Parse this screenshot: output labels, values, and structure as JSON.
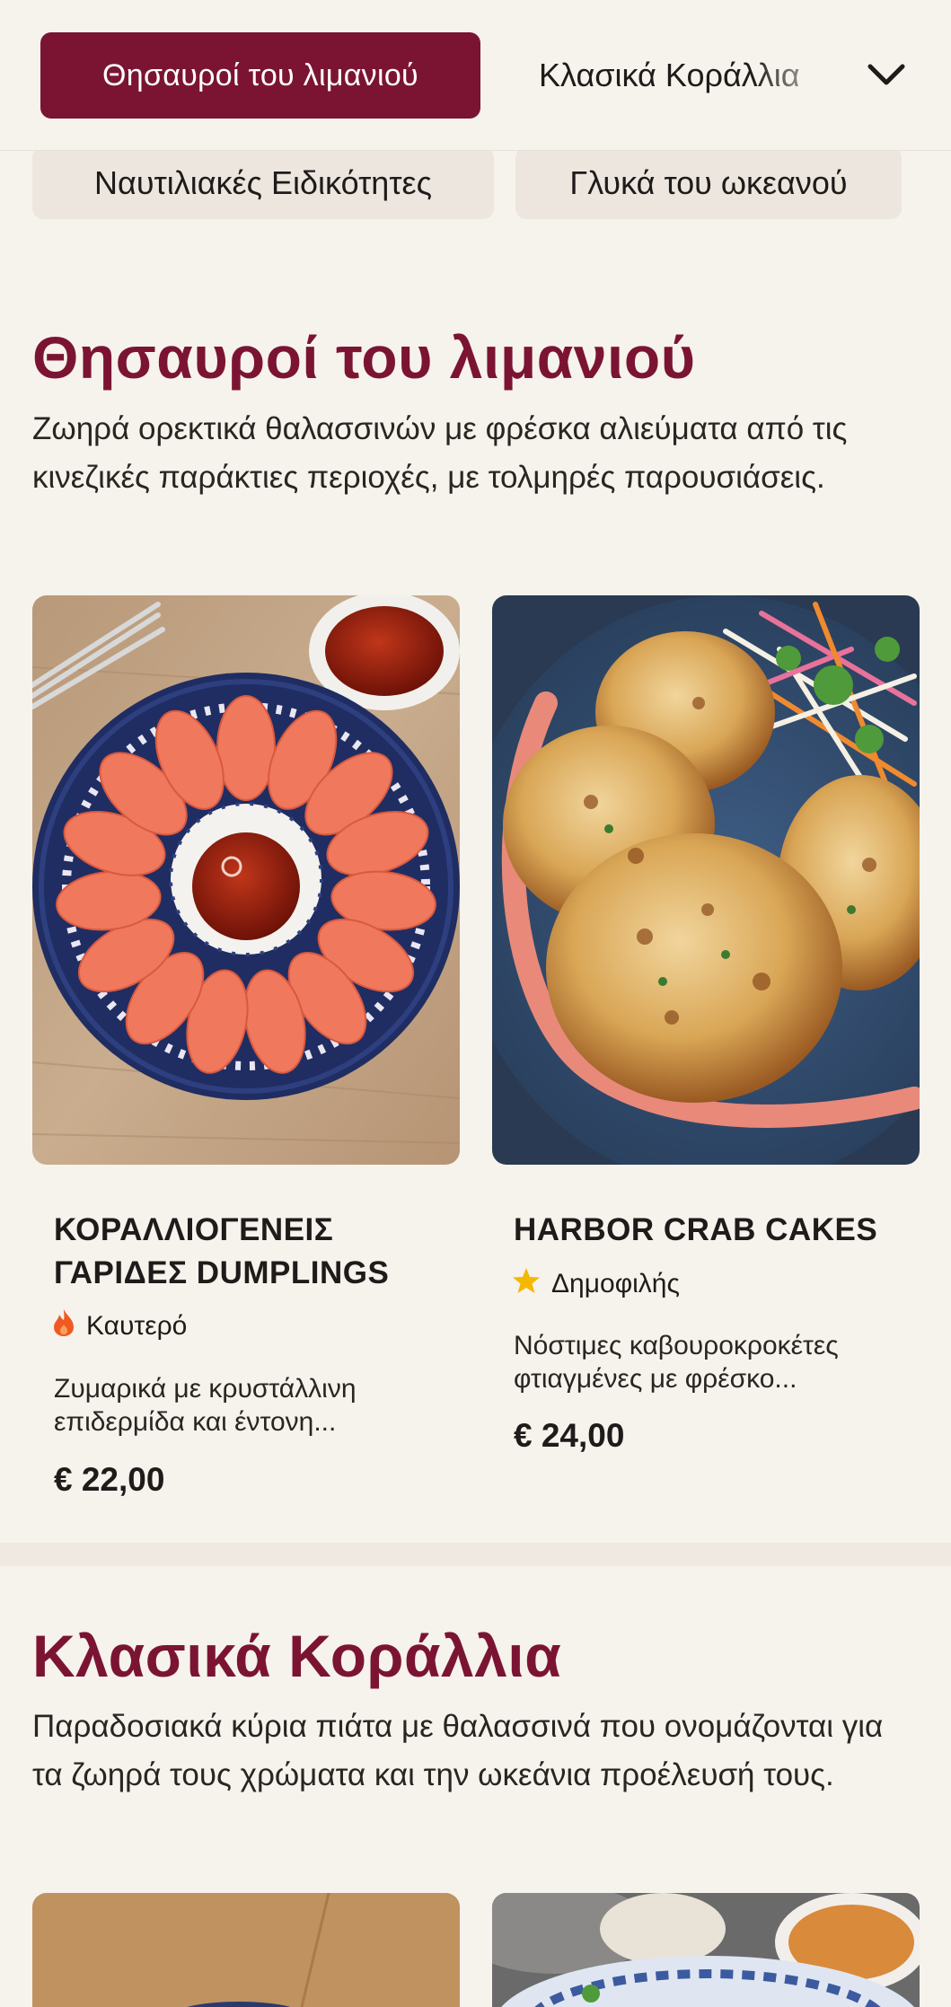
{
  "nav": {
    "active_tab": "Θησαυροί του λιμανιού",
    "next_tab": "Κλασικά Κοράλλια",
    "tabs_row2": [
      "Ναυτιλιακές Ειδικότητες",
      "Γλυκά του ωκεανού"
    ]
  },
  "sections": [
    {
      "title": "Θησαυροί του λιμανιού",
      "description": "Ζωηρά ορεκτικά θαλασσινών με φρέσκα αλιεύματα από τις κινεζικές παράκτιες περιοχές, με τολμηρές παρουσιάσεις.",
      "items": [
        {
          "name": "ΚΟΡΑΛΛΙΟΓΕΝΕΙΣ ΓΑΡΙΔΕΣ DUMPLINGS",
          "badge": "Καυτερό",
          "badge_icon": "flame-icon",
          "description": "Ζυμαρικά με κρυστάλλινη επιδερμίδα και έντονη...",
          "price": "€ 22,00"
        },
        {
          "name": "HARBOR CRAB CAKES",
          "badge": "Δημοφιλής",
          "badge_icon": "star-icon",
          "description": "Νόστιμες καβουροκροκέτες φτιαγμένες με φρέσκο...",
          "price": "€ 24,00"
        }
      ]
    },
    {
      "title": "Κλασικά Κοράλλια",
      "description": "Παραδοσιακά κύρια πιάτα με θαλασσινά που ονομάζονται για τα ζωηρά τους χρώματα και την ωκεάνια προέλευσή τους."
    }
  ],
  "colors": {
    "accent": "#7b1433",
    "background": "#f6f2ec",
    "chip": "#ece6df",
    "flame": "#f05a22",
    "star": "#f5b800"
  }
}
